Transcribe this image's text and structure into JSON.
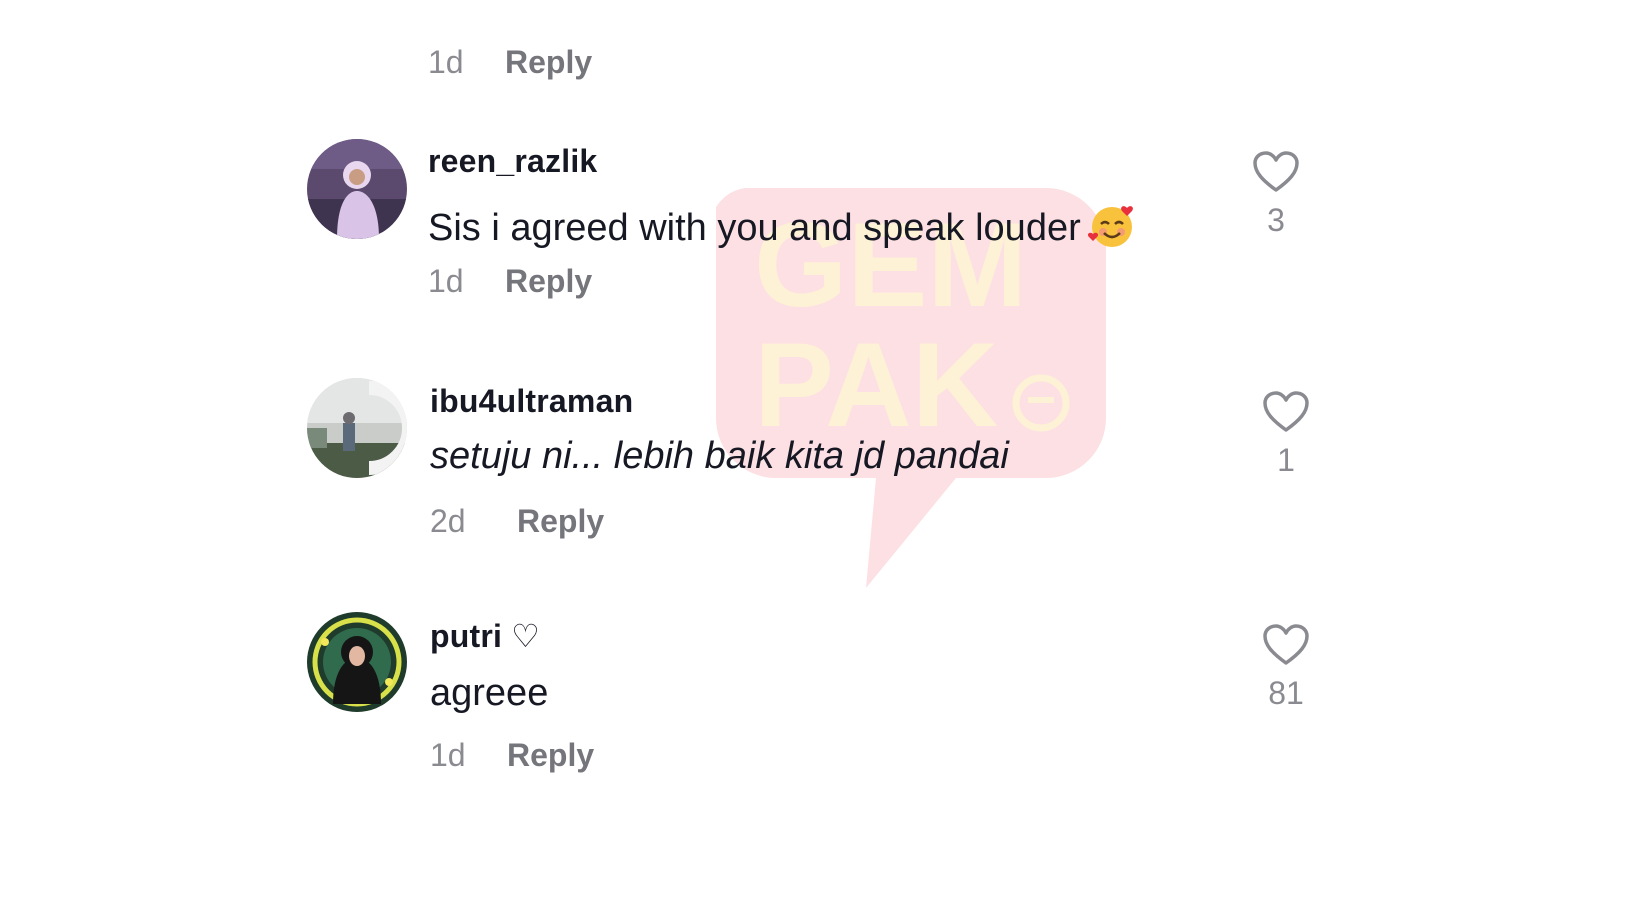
{
  "watermark": {
    "line1": "GEM",
    "line2": "PAK"
  },
  "top_fragment": {
    "time": "1d",
    "reply": "Reply"
  },
  "comments": [
    {
      "username": "reen_razlik",
      "text": "Sis i agreed with you and speak louder",
      "emoji": "smiling-face-with-hearts",
      "time": "1d",
      "reply": "Reply",
      "likes": "3"
    },
    {
      "username": "ibu4ultraman",
      "text": "setuju ni... lebih baik kita jd pandai",
      "time": "2d",
      "reply": "Reply",
      "likes": "1"
    },
    {
      "username": "putri ♡",
      "text": "agreee",
      "time": "1d",
      "reply": "Reply",
      "likes": "81"
    }
  ],
  "colors": {
    "text": "#161823",
    "muted": "#8a8b91",
    "reply": "#75767c",
    "watermark_bg": "#fde0e3",
    "watermark_text": "#fdf1d6"
  }
}
